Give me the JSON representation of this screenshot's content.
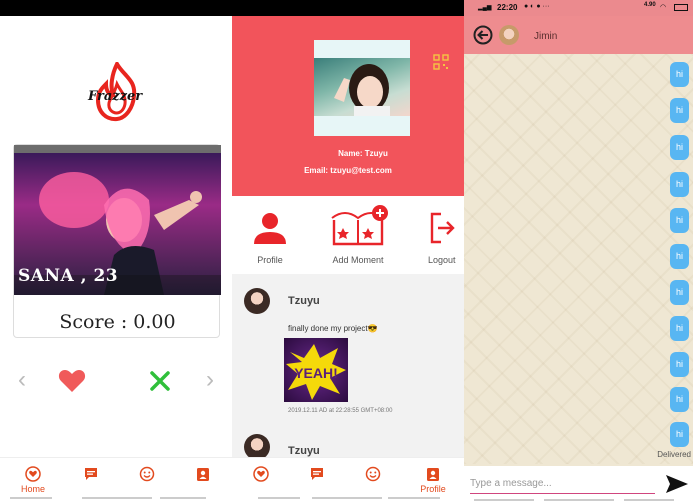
{
  "app1": {
    "logo_text": "Frazzer",
    "card": {
      "name_age": "SANA , 23",
      "score": "Score : 0.00"
    },
    "nav": {
      "home_label": "Home"
    }
  },
  "app2": {
    "profile": {
      "name": "Name: Tzuyu",
      "email": "Email: tzuyu@test.com"
    },
    "actions": {
      "profile": "Profile",
      "add_moment": "Add Moment",
      "logout": "Logout"
    },
    "posts": [
      {
        "author": "Tzuyu",
        "text": "finally done my project😎",
        "image_text": "YEAH!",
        "timestamp": "2019.12.11 AD at 22:28:55 GMT+08:00"
      },
      {
        "author": "Tzuyu"
      }
    ],
    "nav": {
      "profile_label": "Profile"
    }
  },
  "app3": {
    "status": {
      "time": "22:20",
      "net": "4.90"
    },
    "chat": {
      "contact_name": "Jimin",
      "messages": [
        "hi",
        "hi",
        "hi",
        "hi",
        "hi",
        "hi",
        "hi",
        "hi",
        "hi",
        "hi",
        "hi"
      ],
      "delivered": "Delivered",
      "input_placeholder": "Type a message..."
    }
  },
  "colors": {
    "brand_red": "#f2545b",
    "accent_orange": "#e24a1e",
    "chat_header": "#ee8c8f",
    "bubble": "#58b6f2"
  }
}
